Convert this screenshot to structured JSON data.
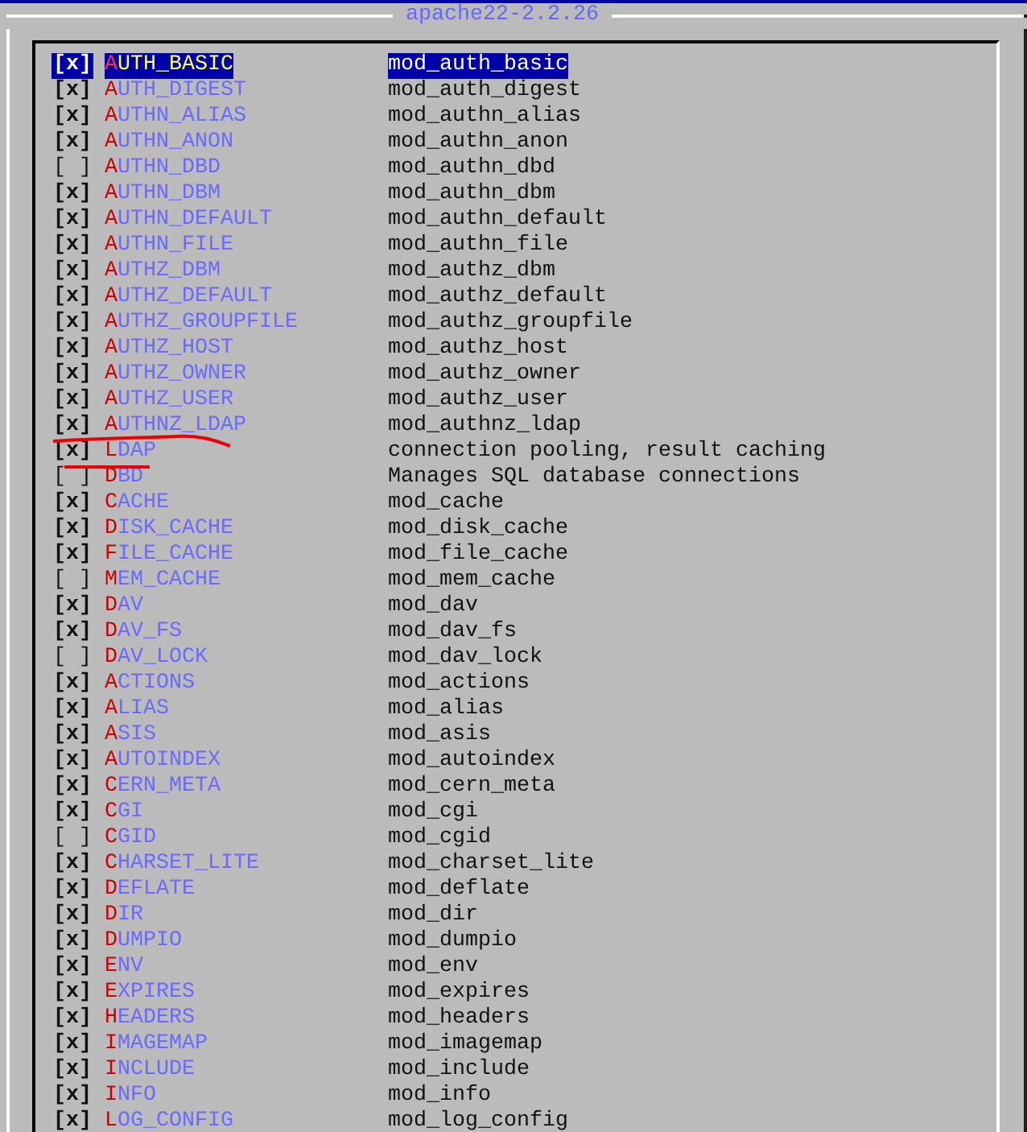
{
  "title": "apache22-2.2.26",
  "items": [
    {
      "box": "[x]",
      "checked": true,
      "name": "AUTH_BASIC",
      "description": "mod_auth_basic",
      "selected": true
    },
    {
      "box": "[x]",
      "checked": true,
      "name": "AUTH_DIGEST",
      "description": "mod_auth_digest",
      "selected": false
    },
    {
      "box": "[x]",
      "checked": true,
      "name": "AUTHN_ALIAS",
      "description": "mod_authn_alias",
      "selected": false
    },
    {
      "box": "[x]",
      "checked": true,
      "name": "AUTHN_ANON",
      "description": "mod_authn_anon",
      "selected": false
    },
    {
      "box": "[ ]",
      "checked": false,
      "name": "AUTHN_DBD",
      "description": "mod_authn_dbd",
      "selected": false
    },
    {
      "box": "[x]",
      "checked": true,
      "name": "AUTHN_DBM",
      "description": "mod_authn_dbm",
      "selected": false
    },
    {
      "box": "[x]",
      "checked": true,
      "name": "AUTHN_DEFAULT",
      "description": "mod_authn_default",
      "selected": false
    },
    {
      "box": "[x]",
      "checked": true,
      "name": "AUTHN_FILE",
      "description": "mod_authn_file",
      "selected": false
    },
    {
      "box": "[x]",
      "checked": true,
      "name": "AUTHZ_DBM",
      "description": "mod_authz_dbm",
      "selected": false
    },
    {
      "box": "[x]",
      "checked": true,
      "name": "AUTHZ_DEFAULT",
      "description": "mod_authz_default",
      "selected": false
    },
    {
      "box": "[x]",
      "checked": true,
      "name": "AUTHZ_GROUPFILE",
      "description": "mod_authz_groupfile",
      "selected": false
    },
    {
      "box": "[x]",
      "checked": true,
      "name": "AUTHZ_HOST",
      "description": "mod_authz_host",
      "selected": false
    },
    {
      "box": "[x]",
      "checked": true,
      "name": "AUTHZ_OWNER",
      "description": "mod_authz_owner",
      "selected": false
    },
    {
      "box": "[x]",
      "checked": true,
      "name": "AUTHZ_USER",
      "description": "mod_authz_user",
      "selected": false
    },
    {
      "box": "[x]",
      "checked": true,
      "name": "AUTHNZ_LDAP",
      "description": "mod_authnz_ldap",
      "selected": false
    },
    {
      "box": "[x]",
      "checked": true,
      "name": "LDAP",
      "description": "connection pooling, result caching",
      "selected": false
    },
    {
      "box": "[ ]",
      "checked": false,
      "name": "DBD",
      "description": "Manages SQL database connections",
      "selected": false
    },
    {
      "box": "[x]",
      "checked": true,
      "name": "CACHE",
      "description": "mod_cache",
      "selected": false
    },
    {
      "box": "[x]",
      "checked": true,
      "name": "DISK_CACHE",
      "description": "mod_disk_cache",
      "selected": false
    },
    {
      "box": "[x]",
      "checked": true,
      "name": "FILE_CACHE",
      "description": "mod_file_cache",
      "selected": false
    },
    {
      "box": "[ ]",
      "checked": false,
      "name": "MEM_CACHE",
      "description": "mod_mem_cache",
      "selected": false
    },
    {
      "box": "[x]",
      "checked": true,
      "name": "DAV",
      "description": "mod_dav",
      "selected": false
    },
    {
      "box": "[x]",
      "checked": true,
      "name": "DAV_FS",
      "description": "mod_dav_fs",
      "selected": false
    },
    {
      "box": "[ ]",
      "checked": false,
      "name": "DAV_LOCK",
      "description": "mod_dav_lock",
      "selected": false
    },
    {
      "box": "[x]",
      "checked": true,
      "name": "ACTIONS",
      "description": "mod_actions",
      "selected": false
    },
    {
      "box": "[x]",
      "checked": true,
      "name": "ALIAS",
      "description": "mod_alias",
      "selected": false
    },
    {
      "box": "[x]",
      "checked": true,
      "name": "ASIS",
      "description": "mod_asis",
      "selected": false
    },
    {
      "box": "[x]",
      "checked": true,
      "name": "AUTOINDEX",
      "description": "mod_autoindex",
      "selected": false
    },
    {
      "box": "[x]",
      "checked": true,
      "name": "CERN_META",
      "description": "mod_cern_meta",
      "selected": false
    },
    {
      "box": "[x]",
      "checked": true,
      "name": "CGI",
      "description": "mod_cgi",
      "selected": false
    },
    {
      "box": "[ ]",
      "checked": false,
      "name": "CGID",
      "description": "mod_cgid",
      "selected": false
    },
    {
      "box": "[x]",
      "checked": true,
      "name": "CHARSET_LITE",
      "description": "mod_charset_lite",
      "selected": false
    },
    {
      "box": "[x]",
      "checked": true,
      "name": "DEFLATE",
      "description": "mod_deflate",
      "selected": false
    },
    {
      "box": "[x]",
      "checked": true,
      "name": "DIR",
      "description": "mod_dir",
      "selected": false
    },
    {
      "box": "[x]",
      "checked": true,
      "name": "DUMPIO",
      "description": "mod_dumpio",
      "selected": false
    },
    {
      "box": "[x]",
      "checked": true,
      "name": "ENV",
      "description": "mod_env",
      "selected": false
    },
    {
      "box": "[x]",
      "checked": true,
      "name": "EXPIRES",
      "description": "mod_expires",
      "selected": false
    },
    {
      "box": "[x]",
      "checked": true,
      "name": "HEADERS",
      "description": "mod_headers",
      "selected": false
    },
    {
      "box": "[x]",
      "checked": true,
      "name": "IMAGEMAP",
      "description": "mod_imagemap",
      "selected": false
    },
    {
      "box": "[x]",
      "checked": true,
      "name": "INCLUDE",
      "description": "mod_include",
      "selected": false
    },
    {
      "box": "[x]",
      "checked": true,
      "name": "INFO",
      "description": "mod_info",
      "selected": false
    },
    {
      "box": "[x]",
      "checked": true,
      "name": "LOG_CONFIG",
      "description": "mod_log_config",
      "selected": false
    }
  ]
}
